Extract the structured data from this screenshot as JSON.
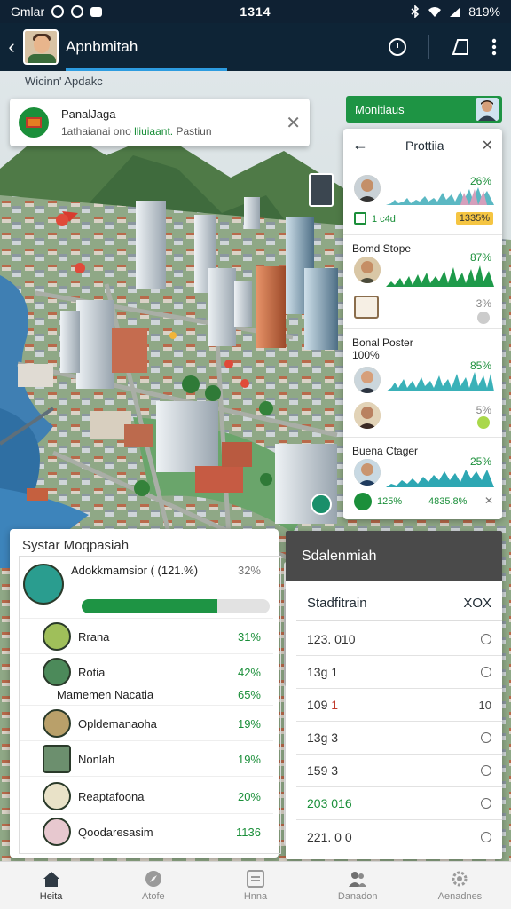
{
  "status_bar": {
    "carrier": "Gmlar",
    "time": "1314",
    "battery": "819%"
  },
  "app_bar": {
    "title": "Apnbmitah"
  },
  "map": {
    "label": "Wicinn' Apdakc"
  },
  "notification": {
    "title": "PanalJaga",
    "sub_prefix": "1athaianai ono",
    "sub_highlight": "lliuiaant.",
    "sub_suffix": "Pastiun"
  },
  "members_pill": {
    "label": "Monitiaus"
  },
  "right_panel": {
    "title": "Prottiia",
    "row1": {
      "pct": "26%",
      "green_label": "1 c4d",
      "badge": "1335%"
    },
    "section2": {
      "label": "Bomd Stope",
      "pct": "87%",
      "toggle_pct": "3%"
    },
    "section3": {
      "label": "Bonal Poster",
      "sub": "100%",
      "pct": "85%",
      "toggle_pct": "5%"
    },
    "section4": {
      "label": "Buena Ctager",
      "pct": "25%",
      "left_val": "125%",
      "right_val": "4835.8%"
    }
  },
  "system_panel": {
    "title": "Systar Moqpasiah",
    "top_item": {
      "label": "Adokkmamsior ( (121.%)",
      "pct": "32%",
      "progress": 0.72
    },
    "items": [
      {
        "label": "Rrana",
        "pct": "31%"
      },
      {
        "label": "Rotia",
        "pct": "42%"
      },
      {
        "label": "Mamemen Nacatia",
        "pct": "65%"
      },
      {
        "label": "Opldemanaoha",
        "pct": "19%"
      },
      {
        "label": "Nonlah",
        "pct": "19%"
      },
      {
        "label": "Reaptafoona",
        "pct": "20%"
      },
      {
        "label": "Qoodaresasim",
        "pct": "1136"
      }
    ]
  },
  "schedule_panel": {
    "title": "Sdalenmiah",
    "sub_label": "Stadfitrain",
    "sub_value": "XOX",
    "rows": [
      {
        "value": "123. 010",
        "ctl": ""
      },
      {
        "value": "13g 1",
        "ctl": ""
      },
      {
        "value": "109",
        "red": "1",
        "ctl": "10"
      },
      {
        "value": "13g 3",
        "ctl": ""
      },
      {
        "value": "159 3",
        "ctl": ""
      },
      {
        "value": "203 016",
        "ctl": ""
      },
      {
        "value": "221. 0 0",
        "ctl": ""
      }
    ]
  },
  "bottom_nav": [
    {
      "label": "Heita"
    },
    {
      "label": "Atofe"
    },
    {
      "label": "Hnna"
    },
    {
      "label": "Danadon"
    },
    {
      "label": "Aenadnes"
    }
  ]
}
